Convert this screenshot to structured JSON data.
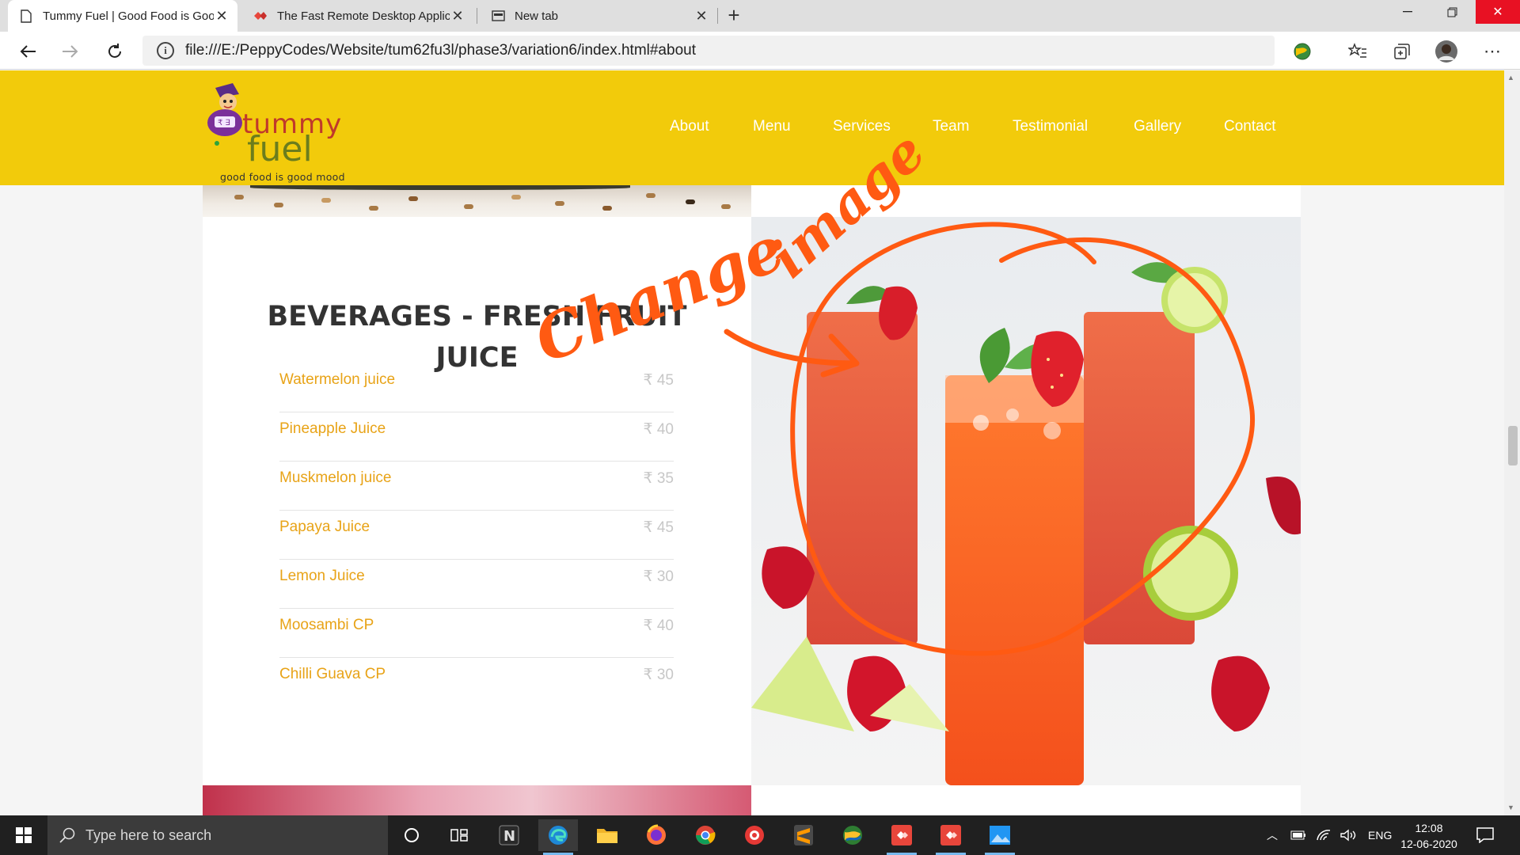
{
  "browser": {
    "tabs": [
      {
        "title": "Tummy Fuel | Good Food is Good Mood",
        "active": true
      },
      {
        "title": "The Fast Remote Desktop Application",
        "active": false
      },
      {
        "title": "New tab",
        "active": false
      }
    ],
    "url": "file:///E:/PeppyCodes/Website/tum62fu3l/phase3/variation6/index.html#about"
  },
  "site": {
    "logo": {
      "word1": "tummy",
      "word2": "fuel",
      "tagline": "good food is good mood"
    },
    "nav": [
      "About",
      "Menu",
      "Services",
      "Team",
      "Testimonial",
      "Gallery",
      "Contact"
    ],
    "menu": {
      "title_line1": "BEVERAGES - FRESH FRUIT",
      "title_line2": "JUICE",
      "items": [
        {
          "name": "Watermelon juice",
          "price": "₹ 45"
        },
        {
          "name": "Pineapple Juice",
          "price": "₹ 40"
        },
        {
          "name": "Muskmelon juice",
          "price": "₹ 35"
        },
        {
          "name": "Papaya Juice",
          "price": "₹ 45"
        },
        {
          "name": "Lemon Juice",
          "price": "₹ 30"
        },
        {
          "name": "Moosambi CP",
          "price": "₹ 40"
        },
        {
          "name": "Chilli Guava CP",
          "price": "₹ 30"
        }
      ]
    }
  },
  "annotation": {
    "word1": "Change",
    "word2": "image",
    "color": "#ff5a12"
  },
  "taskbar": {
    "search_placeholder": "Type here to search",
    "language": "ENG",
    "time": "12:08",
    "date": "12-06-2020"
  },
  "colors": {
    "header": "#f2cb0b",
    "accent": "#e8a317",
    "price": "#c7c7c7"
  }
}
